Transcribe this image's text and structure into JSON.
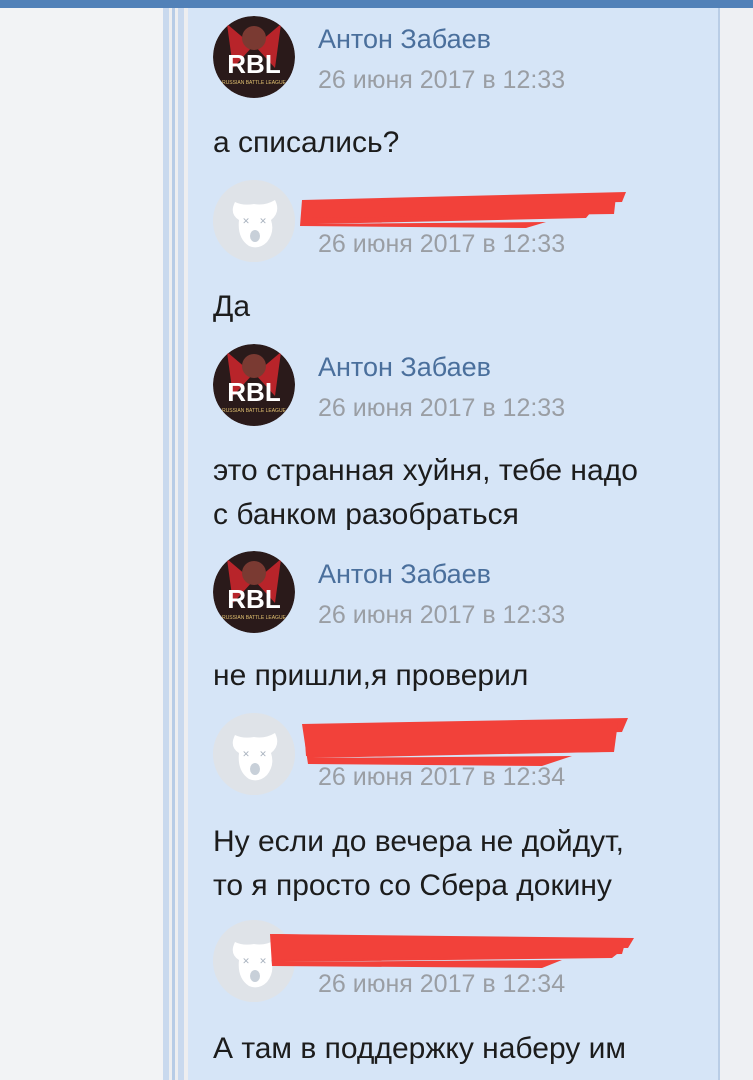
{
  "messages": [
    {
      "author": "Антон Забаев",
      "date": "26 июня 2017 в 12:33",
      "lines": [
        "а списались?"
      ],
      "avatar": "rbl-logo-avatar"
    },
    {
      "author": "",
      "date": "26 июня 2017 в 12:33",
      "lines": [
        "Да"
      ],
      "avatar": "default-dog-avatar"
    },
    {
      "author": "Антон Забаев",
      "date": "26 июня 2017 в 12:33",
      "lines": [
        "это странная хуйня, тебе надо",
        "с банком разобраться"
      ],
      "avatar": "rbl-logo-avatar"
    },
    {
      "author": "Антон Забаев",
      "date": "26 июня 2017 в 12:33",
      "lines": [
        "не пришли,я проверил"
      ],
      "avatar": "rbl-logo-avatar"
    },
    {
      "author": "",
      "date": "26 июня 2017 в 12:34",
      "lines": [
        "Ну если до вечера не дойдут,",
        "то я просто со Сбера докину"
      ],
      "avatar": "default-dog-avatar"
    },
    {
      "author": "",
      "date": "26 июня 2017 в 12:34",
      "lines": [
        "А там в поддержку наберу им"
      ],
      "avatar": "default-dog-avatar"
    }
  ],
  "colors": {
    "panel": "#d6e5f7",
    "author_link": "#4a6f9c",
    "date": "#9a9ea4",
    "redaction": "#f2413a",
    "top_bar": "#5181b8"
  }
}
